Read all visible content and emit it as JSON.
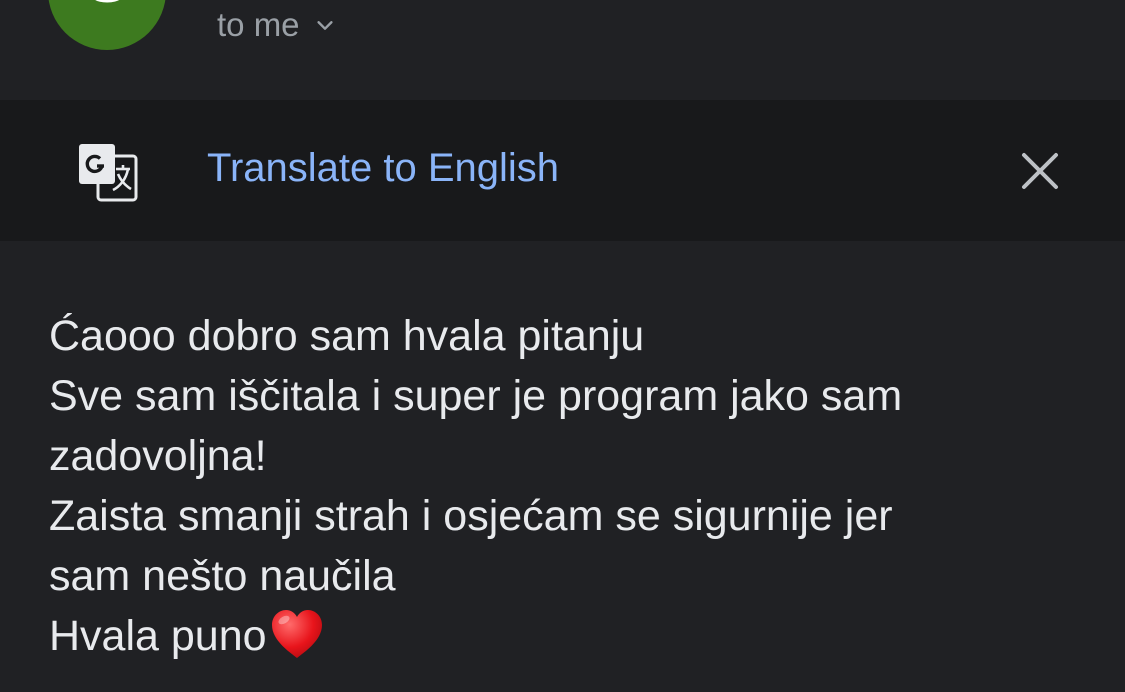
{
  "sender": {
    "avatar_letter": "S",
    "avatar_color": "#3d7a1f",
    "recipient_label": "to me",
    "recipient_icon": "chevron-down-icon"
  },
  "translate_bar": {
    "icon": "google-translate-icon",
    "link_text": "Translate to English",
    "link_color": "#8ab4f8",
    "close_icon": "close-icon"
  },
  "message": {
    "lines": [
      "Ćaooo dobro sam hvala pitanju",
      "Sve sam iščitala i super je program jako sam",
      "zadovoljna!",
      "Zaista smanji strah i osjećam se sigurnije jer",
      "sam nešto naučila",
      "Hvala puno"
    ],
    "trailing_emoji": "red-heart-emoji"
  },
  "colors": {
    "background": "#202124",
    "translate_bar_bg": "#18191b",
    "body_text": "#e8eaed",
    "secondary_text": "#9aa0a6"
  }
}
